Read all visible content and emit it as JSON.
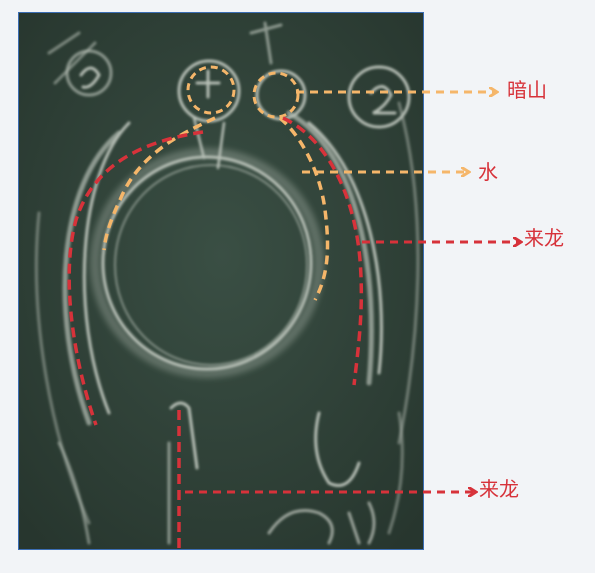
{
  "labels": {
    "dark_mountain": "暗山",
    "water": "水",
    "incoming_dragon_right": "来龙",
    "incoming_dragon_bottom": "来龙"
  },
  "colors": {
    "orange": "#f5b66a",
    "red": "#d7323a",
    "chalkboard": "#34473d",
    "chalk": "#d9ddd3",
    "frame_border": "#3b6db3"
  }
}
